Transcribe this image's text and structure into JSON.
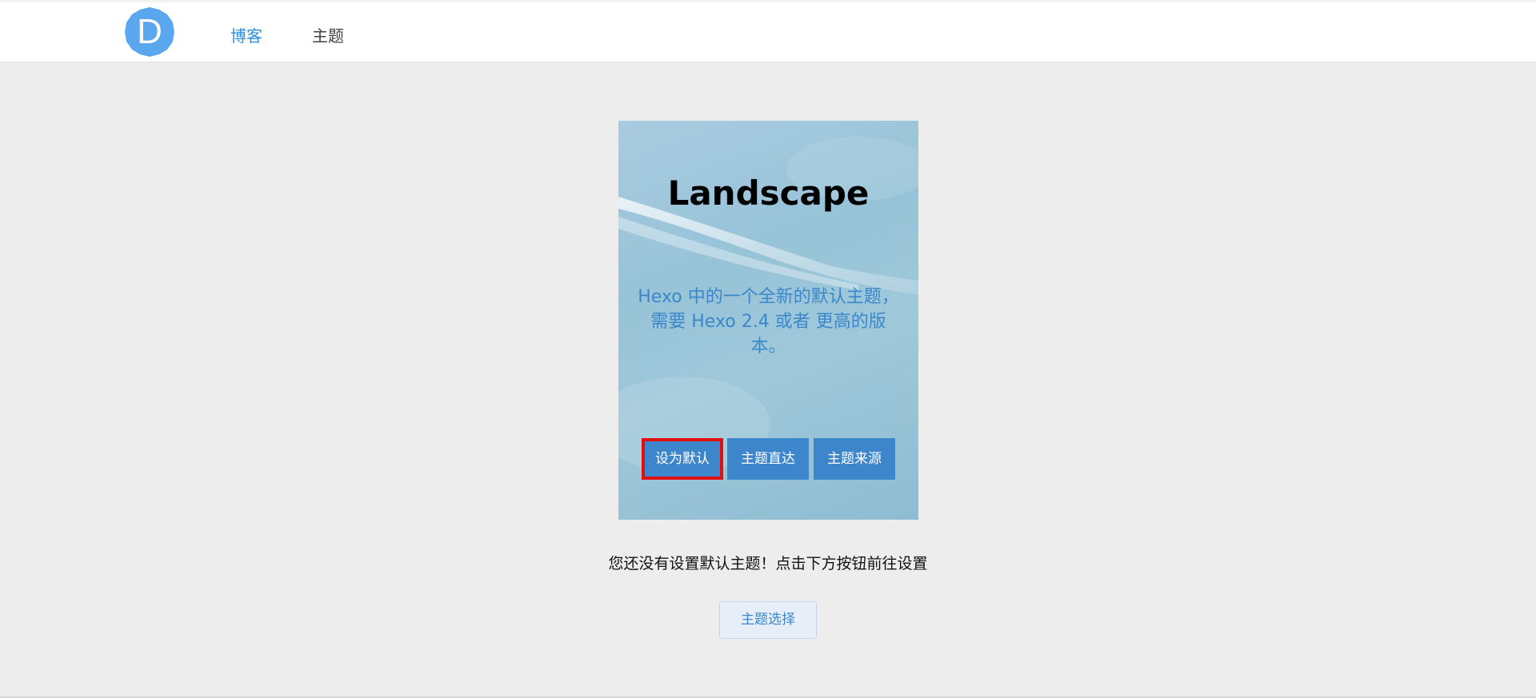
{
  "nav": {
    "logo_letter": "D",
    "items": [
      {
        "label": "博客",
        "active": true
      },
      {
        "label": "主题",
        "active": false
      }
    ]
  },
  "theme_card": {
    "title": "Landscape",
    "description": "Hexo 中的一个全新的默认主题，需要 Hexo 2.4 或者 更高的版本。",
    "buttons": {
      "set_default": "设为默认",
      "direct": "主题直达",
      "source": "主题来源"
    }
  },
  "notice": "您还没有设置默认主题！点击下方按钮前往设置",
  "select_button": "主题选择",
  "colors": {
    "accent": "#2f8ee0",
    "button": "#3d86cb",
    "highlight_border": "#e01010",
    "background": "#ededed"
  }
}
